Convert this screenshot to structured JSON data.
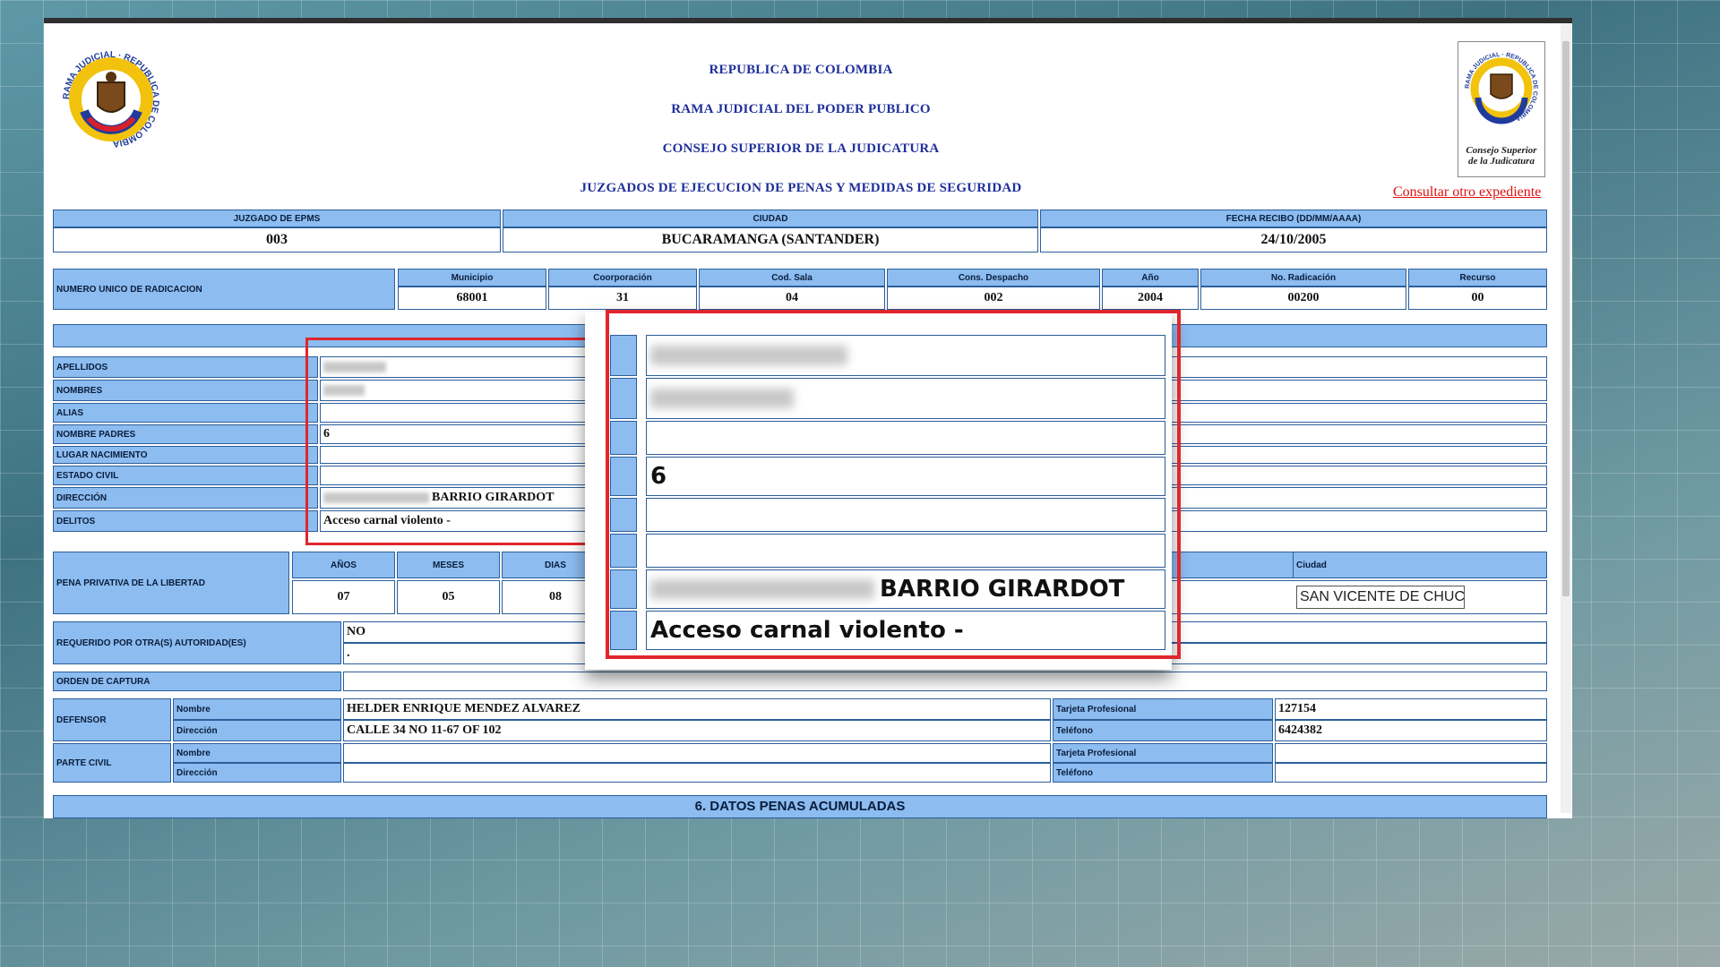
{
  "header": {
    "line1": "REPUBLICA DE COLOMBIA",
    "line2": "RAMA JUDICIAL DEL PODER PUBLICO",
    "line3": "CONSEJO SUPERIOR DE LA JUDICATURA",
    "line4": "JUZGADOS DE EJECUCION DE PENAS Y MEDIDAS DE SEGURIDAD",
    "logo_left_text": "RAMA JUDICIAL · REPUBLICA DE COLOMBIA",
    "logo_right_text": "RAMA JUDICIAL · REPUBLICA DE COLOMBIA",
    "logo_right_caption1": "Consejo Superior",
    "logo_right_caption2": "de la Judicatura",
    "consult_link": "Consultar otro expediente"
  },
  "summary": {
    "juzgado_label": "JUZGADO DE EPMS",
    "juzgado_value": "003",
    "ciudad_label": "CIUDAD",
    "ciudad_value": "BUCARAMANGA (SANTANDER)",
    "fecha_label": "FECHA RECIBO (DD/MM/AAAA)",
    "fecha_value": "24/10/2005"
  },
  "radicacion": {
    "label": "NUMERO UNICO DE RADICACION",
    "municipio_label": "Municipio",
    "municipio": "68001",
    "corporacion_label": "Coorporación",
    "corporacion": "31",
    "sala_label": "Cod. Sala",
    "sala": "04",
    "despacho_label": "Cons. Despacho",
    "despacho": "002",
    "anio_label": "Año",
    "anio": "2004",
    "radicacion_label": "No. Radicación",
    "radicacion": "00200",
    "recurso_label": "Recurso",
    "recurso": "00"
  },
  "person": {
    "apellidos_label": "APELLIDOS",
    "nombres_label": "NOMBRES",
    "alias_label": "ALIAS",
    "padres_label": "NOMBRE PADRES",
    "padres_value": "6",
    "nacimiento_label": "LUGAR NACIMIENTO",
    "civil_label": "ESTADO CIVIL",
    "direccion_label": "DIRECCIÓN",
    "direccion_value": "BARRIO GIRARDOT",
    "delitos_label": "DELITOS",
    "delitos_value": "Acceso carnal violento -"
  },
  "pena": {
    "label": "PENA PRIVATIVA DE LA LIBERTAD",
    "anios_label": "AÑOS",
    "anios": "07",
    "meses_label": "MESES",
    "meses": "05",
    "dias_label": "DIAS",
    "dias": "08",
    "ciudad_label": "Ciudad",
    "ciudad_value": "SAN VICENTE DE CHUCUF"
  },
  "requerido": {
    "label": "REQUERIDO POR OTRA(S) AUTORIDAD(ES)",
    "value1": "NO",
    "value2": "."
  },
  "captura": {
    "label": "ORDEN DE CAPTURA"
  },
  "defensor": {
    "label": "DEFENSOR",
    "nombre_label": "Nombre",
    "nombre": "HELDER ENRIQUE MENDEZ ALVAREZ",
    "direccion_label": "Dirección",
    "direccion": "CALLE 34 NO 11-67 OF 102",
    "tarjeta_label": "Tarjeta Profesional",
    "tarjeta": "127154",
    "telefono_label": "Teléfono",
    "telefono": "6424382"
  },
  "parte_civil": {
    "label": "PARTE CIVIL",
    "nombre_label": "Nombre",
    "direccion_label": "Dirección",
    "tarjeta_label": "Tarjeta Profesional",
    "telefono_label": "Teléfono"
  },
  "section6": {
    "title": "6. DATOS PENAS ACUMULADAS"
  },
  "colors": {
    "label_bg": "#8cbcf0",
    "border": "#2c5e9a",
    "highlight": "#e0262c",
    "title": "#1f2f9a",
    "link": "#e01010"
  }
}
